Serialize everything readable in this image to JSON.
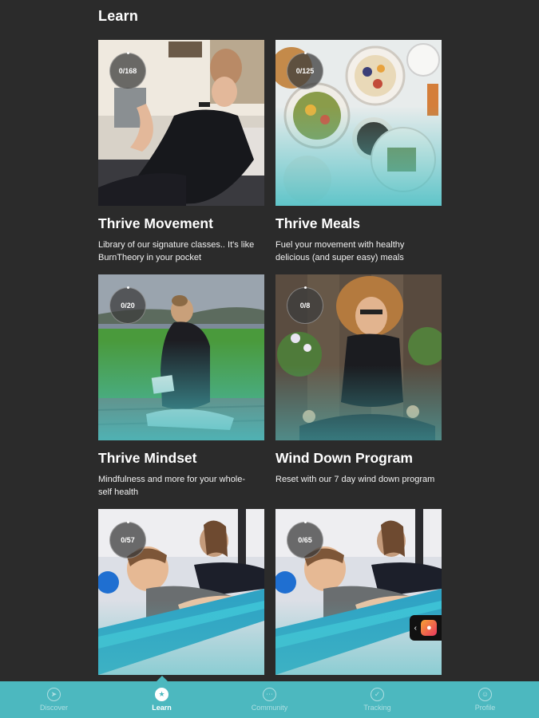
{
  "page": {
    "title": "Learn"
  },
  "programs": [
    {
      "title": "Thrive Movement",
      "description": "Library of our signature classes.. It's like BurnTheory in your pocket",
      "progress": "0/168"
    },
    {
      "title": "Thrive Meals",
      "description": "Fuel your movement with healthy delicious (and super easy) meals",
      "progress": "0/125"
    },
    {
      "title": "Thrive Mindset",
      "description": "Mindfulness and more for your whole-self health",
      "progress": "0/20"
    },
    {
      "title": "Wind Down Program",
      "description": "Reset with our 7 day wind down program",
      "progress": "0/8"
    },
    {
      "title": "",
      "description": "",
      "progress": "0/57"
    },
    {
      "title": "",
      "description": "",
      "progress": "0/65"
    }
  ],
  "nav": {
    "items": [
      {
        "label": "Discover",
        "icon": "compass-icon"
      },
      {
        "label": "Learn",
        "icon": "learn-icon",
        "active": true
      },
      {
        "label": "Community",
        "icon": "chat-icon"
      },
      {
        "label": "Tracking",
        "icon": "tracking-icon"
      },
      {
        "label": "Profile",
        "icon": "profile-icon"
      }
    ]
  },
  "colors": {
    "background": "#2b2b2b",
    "accent": "#4cb8bf"
  }
}
